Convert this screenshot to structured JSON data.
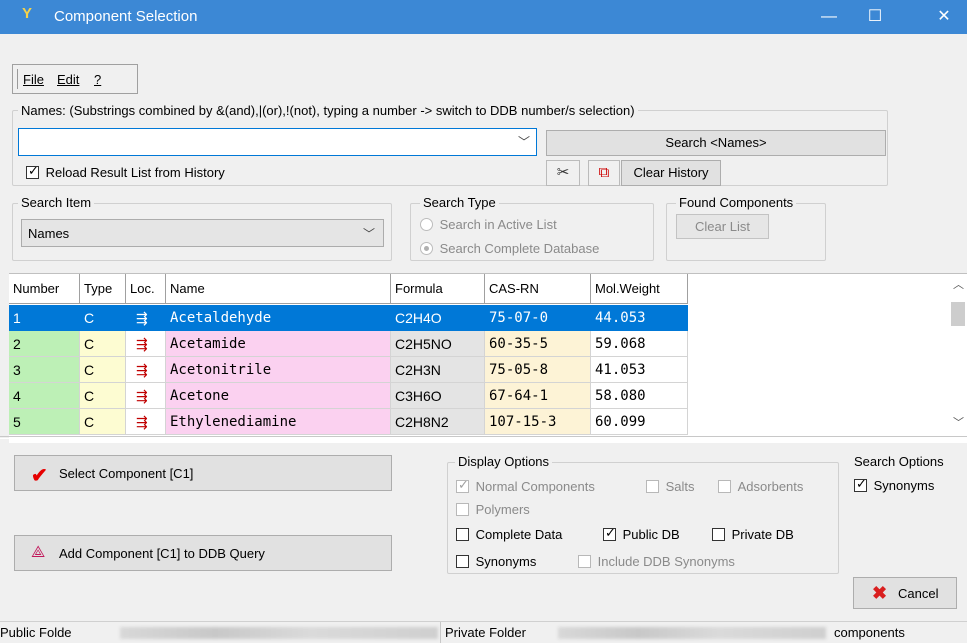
{
  "window": {
    "title": "Component Selection",
    "minimize": "—",
    "maximize": "☐",
    "close": "✕"
  },
  "menu": {
    "file": "File",
    "edit": "Edit",
    "help": "?"
  },
  "names_section": {
    "label": "Names: (Substrings combined by &(and),|(or),!(not), typing a number -> switch to DDB number/s selection)",
    "input_value": "",
    "search_button": "Search <Names>",
    "reload_label": "Reload Result List from History",
    "reload_checked": true,
    "clear_history": "Clear History"
  },
  "search_item": {
    "label": "Search Item",
    "selected": "Names"
  },
  "search_type": {
    "label": "Search Type",
    "options": [
      "Search in  Active List",
      "Search Complete Database"
    ],
    "selected_index": 1
  },
  "found_components": {
    "label": "Found Components",
    "clear_list": "Clear List"
  },
  "table": {
    "columns": [
      "Number",
      "Type",
      "Loc.",
      "Name",
      "Formula",
      "CAS-RN",
      "Mol.Weight"
    ],
    "rows": [
      {
        "number": "1",
        "type": "C",
        "name": "Acetaldehyde",
        "formula": "C2H4O",
        "cas": "75-07-0",
        "mw": "44.053"
      },
      {
        "number": "2",
        "type": "C",
        "name": "Acetamide",
        "formula": "C2H5NO",
        "cas": "60-35-5",
        "mw": "59.068"
      },
      {
        "number": "3",
        "type": "C",
        "name": "Acetonitrile",
        "formula": "C2H3N",
        "cas": "75-05-8",
        "mw": "41.053"
      },
      {
        "number": "4",
        "type": "C",
        "name": "Acetone",
        "formula": "C3H6O",
        "cas": "67-64-1",
        "mw": "58.080"
      },
      {
        "number": "5",
        "type": "C",
        "name": "Ethylenediamine",
        "formula": "C2H8N2",
        "cas": "107-15-3",
        "mw": "60.099"
      }
    ],
    "selected_row": 0
  },
  "actions": {
    "select_component": "Select Component [C1]",
    "add_component": "Add Component [C1] to DDB Query",
    "cancel": "Cancel"
  },
  "display_options": {
    "label": "Display Options",
    "normal_components": "Normal Components",
    "salts": "Salts",
    "adsorbents": "Adsorbents",
    "polymers": "Polymers",
    "complete_data": "Complete Data",
    "public_db": "Public DB",
    "private_db": "Private DB",
    "synonyms": "Synonyms",
    "include_ddb_synonyms": "Include DDB Synonyms"
  },
  "search_options": {
    "label": "Search Options",
    "synonyms": "Synonyms"
  },
  "status": {
    "public_folder": "Public Folde",
    "private_folder": "Private Folder",
    "components": "components"
  },
  "colors": {
    "titlebar": "#3c88d5",
    "selection": "#0078d7",
    "number_col": "#bdf0b6",
    "type_col": "#fdfcd2",
    "name_col": "#fbd1f0",
    "formula_col": "#e4e4e4",
    "cas_col": "#fdf3d6",
    "check_red": "#e60000",
    "cancel_red": "#d91f1f"
  }
}
